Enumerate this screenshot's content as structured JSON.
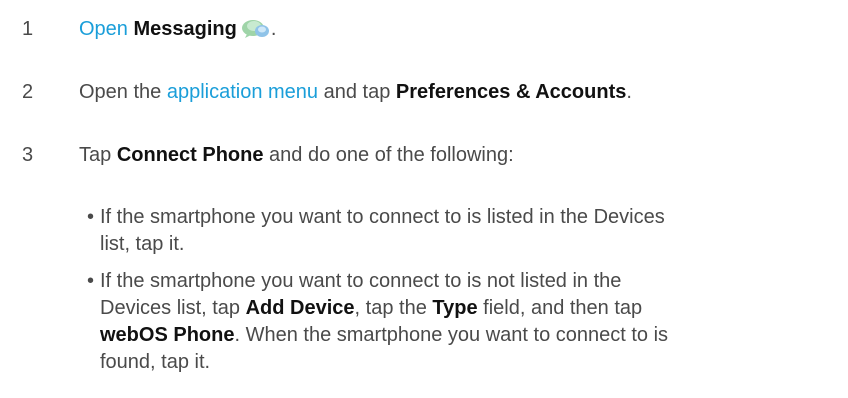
{
  "steps": [
    {
      "number": "1",
      "parts": {
        "a": "Open",
        "b": " ",
        "c": "Messaging",
        "d": "."
      }
    },
    {
      "number": "2",
      "parts": {
        "a": "Open the ",
        "b": "application menu",
        "c": " and tap ",
        "d": "Preferences & Accounts",
        "e": "."
      }
    },
    {
      "number": "3",
      "parts": {
        "a": "Tap ",
        "b": "Connect Phone",
        "c": " and do one of the following:"
      }
    }
  ],
  "bullets": [
    {
      "dot": "•",
      "line1": "If the smartphone you want to connect to is listed in the Devices",
      "line2": "list, tap it."
    },
    {
      "dot": "•",
      "line1": "If the smartphone you want to connect to is not listed in the",
      "line2a": "Devices list, tap ",
      "line2b": "Add Device",
      "line2c": ", tap the ",
      "line2d": "Type",
      "line2e": " field, and then tap",
      "line3a": "webOS Phone",
      "line3b": ". When the smartphone you want to connect to is",
      "line4": "found, tap it."
    }
  ],
  "icon": "messaging-icon"
}
